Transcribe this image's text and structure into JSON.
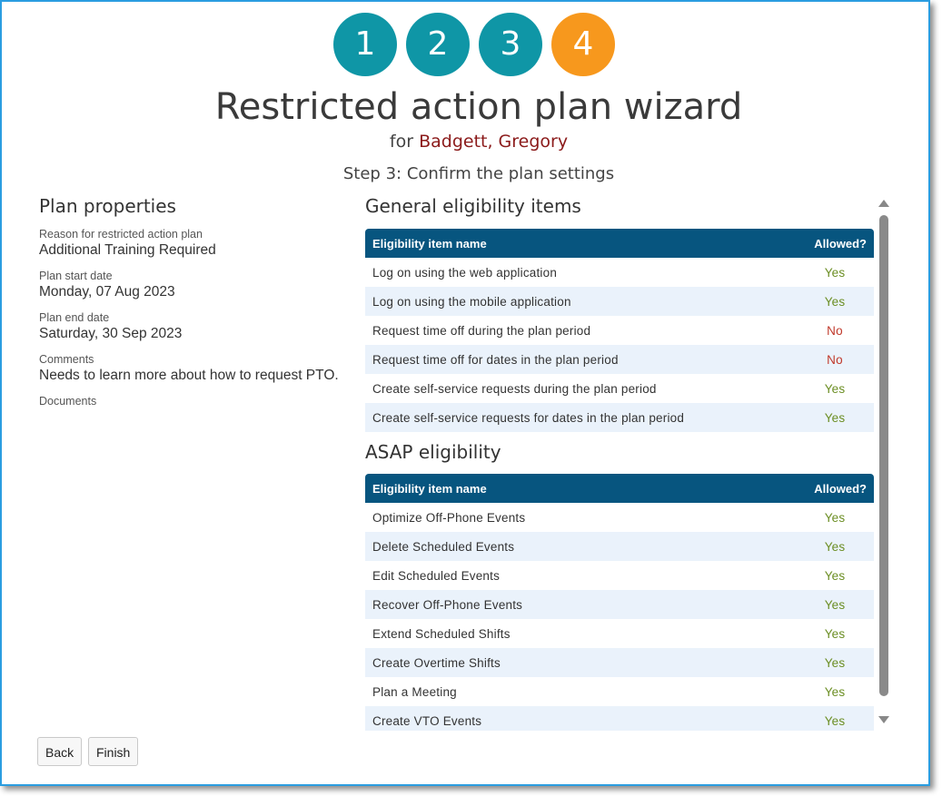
{
  "wizard": {
    "steps": [
      "1",
      "2",
      "3",
      "4"
    ],
    "current_step": 4,
    "title": "Restricted action plan wizard",
    "for_label": "for",
    "employee_name": "Badgett, Gregory",
    "step_title": "Step 3: Confirm the plan settings"
  },
  "plan": {
    "heading": "Plan properties",
    "reason_label": "Reason for restricted action plan",
    "reason_value": "Additional Training Required",
    "start_label": "Plan start date",
    "start_value": "Monday, 07 Aug 2023",
    "end_label": "Plan end date",
    "end_value": "Saturday, 30 Sep 2023",
    "comments_label": "Comments",
    "comments_value": "Needs to learn more about how to request PTO.",
    "documents_label": "Documents"
  },
  "general": {
    "heading": "General eligibility items",
    "col_name": "Eligibility item name",
    "col_allowed": "Allowed?",
    "rows": [
      {
        "name": "Log on using the web application",
        "allowed": "Yes"
      },
      {
        "name": "Log on using the mobile application",
        "allowed": "Yes"
      },
      {
        "name": "Request time off during the plan period",
        "allowed": "No"
      },
      {
        "name": "Request time off for dates in the plan period",
        "allowed": "No"
      },
      {
        "name": "Create self-service requests during the plan period",
        "allowed": "Yes"
      },
      {
        "name": "Create self-service requests for dates in the plan period",
        "allowed": "Yes"
      }
    ]
  },
  "asap": {
    "heading": "ASAP eligibility",
    "col_name": "Eligibility item name",
    "col_allowed": "Allowed?",
    "rows": [
      {
        "name": "Optimize Off-Phone Events",
        "allowed": "Yes"
      },
      {
        "name": "Delete Scheduled Events",
        "allowed": "Yes"
      },
      {
        "name": "Edit Scheduled Events",
        "allowed": "Yes"
      },
      {
        "name": "Recover Off-Phone Events",
        "allowed": "Yes"
      },
      {
        "name": "Extend Scheduled Shifts",
        "allowed": "Yes"
      },
      {
        "name": "Create Overtime Shifts",
        "allowed": "Yes"
      },
      {
        "name": "Plan a Meeting",
        "allowed": "Yes"
      },
      {
        "name": "Create VTO Events",
        "allowed": "Yes"
      }
    ]
  },
  "buttons": {
    "back": "Back",
    "finish": "Finish"
  },
  "colors": {
    "step_done": "#0f96a6",
    "step_current": "#f7981d",
    "table_header": "#07557f",
    "yes": "#6b8e23",
    "no": "#c0392b",
    "employee_name": "#8b1a1a"
  }
}
